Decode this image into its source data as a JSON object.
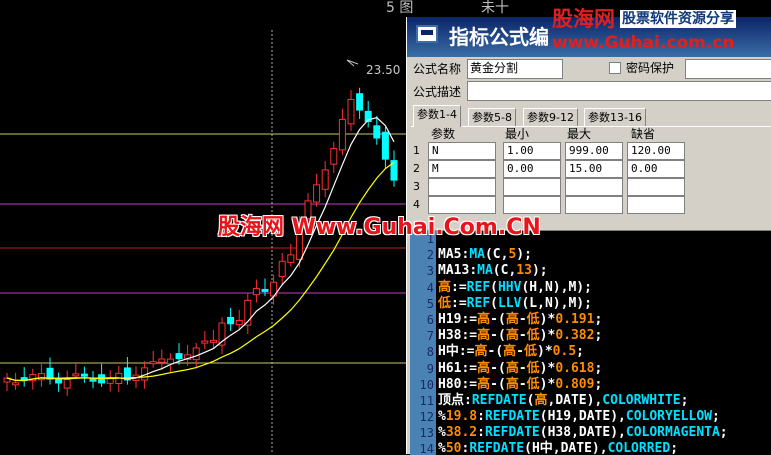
{
  "top_fragments": {
    "left": "5 图",
    "mid": "未十"
  },
  "chart_data": {
    "type": "candlestick",
    "peak_label": "23.50",
    "levels_note": "horizontal golden-section lines",
    "colors": {
      "up": "#ff3030",
      "down": "#00ffff",
      "ma5": "#ffffff",
      "ma13": "#ffff00",
      "line_yellow": "#ffff80",
      "line_magenta": "#c040c0",
      "line_red": "#c02020"
    }
  },
  "dialog": {
    "title": "指标公式编",
    "name_label": "公式名称",
    "name_value": "黄金分割",
    "password_label": "密码保护",
    "desc_label": "公式描述",
    "desc_value": "",
    "tabs": [
      "参数1-4",
      "参数5-8",
      "参数9-12",
      "参数13-16"
    ],
    "param_headers": [
      "参数",
      "最小",
      "最大",
      "缺省"
    ],
    "params": [
      {
        "n": "1",
        "name": "N",
        "min": "1.00",
        "max": "999.00",
        "def": "120.00"
      },
      {
        "n": "2",
        "name": "M",
        "min": "0.00",
        "max": "15.00",
        "def": "0.00"
      },
      {
        "n": "3",
        "name": "",
        "min": "",
        "max": "",
        "def": ""
      },
      {
        "n": "4",
        "name": "",
        "min": "",
        "max": "",
        "def": ""
      }
    ],
    "code": [
      {
        "n": "1",
        "tokens": []
      },
      {
        "n": "2",
        "tokens": [
          [
            "id",
            "MA5"
          ],
          [
            "op",
            ":"
          ],
          [
            "fn",
            "MA"
          ],
          [
            "op",
            "("
          ],
          [
            "id",
            "C"
          ],
          [
            "op",
            ","
          ],
          [
            "num",
            "5"
          ],
          [
            "op",
            ");"
          ]
        ]
      },
      {
        "n": "3",
        "tokens": [
          [
            "id",
            "MA13"
          ],
          [
            "op",
            ":"
          ],
          [
            "fn",
            "MA"
          ],
          [
            "op",
            "("
          ],
          [
            "id",
            "C"
          ],
          [
            "op",
            ","
          ],
          [
            "num",
            "13"
          ],
          [
            "op",
            ");"
          ]
        ]
      },
      {
        "n": "4",
        "tokens": [
          [
            "cn",
            "高"
          ],
          [
            "op",
            ":="
          ],
          [
            "fn",
            "REF"
          ],
          [
            "op",
            "("
          ],
          [
            "fn",
            "HHV"
          ],
          [
            "op",
            "("
          ],
          [
            "id",
            "H"
          ],
          [
            "op",
            ","
          ],
          [
            "id",
            "N"
          ],
          [
            "op",
            "),"
          ],
          [
            "id",
            "M"
          ],
          [
            "op",
            ");"
          ]
        ]
      },
      {
        "n": "5",
        "tokens": [
          [
            "cn",
            "低"
          ],
          [
            "op",
            ":="
          ],
          [
            "fn",
            "REF"
          ],
          [
            "op",
            "("
          ],
          [
            "fn",
            "LLV"
          ],
          [
            "op",
            "("
          ],
          [
            "id",
            "L"
          ],
          [
            "op",
            ","
          ],
          [
            "id",
            "N"
          ],
          [
            "op",
            "),"
          ],
          [
            "id",
            "M"
          ],
          [
            "op",
            ");"
          ]
        ]
      },
      {
        "n": "6",
        "tokens": [
          [
            "id",
            "H19"
          ],
          [
            "op",
            ":="
          ],
          [
            "cn",
            "高"
          ],
          [
            "op",
            "-("
          ],
          [
            "cn",
            "高"
          ],
          [
            "op",
            "-"
          ],
          [
            "cn",
            "低"
          ],
          [
            "op",
            ")*"
          ],
          [
            "num",
            "0.191"
          ],
          [
            "op",
            ";"
          ]
        ]
      },
      {
        "n": "7",
        "tokens": [
          [
            "id",
            "H38"
          ],
          [
            "op",
            ":="
          ],
          [
            "cn",
            "高"
          ],
          [
            "op",
            "-("
          ],
          [
            "cn",
            "高"
          ],
          [
            "op",
            "-"
          ],
          [
            "cn",
            "低"
          ],
          [
            "op",
            ")*"
          ],
          [
            "num",
            "0.382"
          ],
          [
            "op",
            ";"
          ]
        ]
      },
      {
        "n": "8",
        "tokens": [
          [
            "id",
            "H中"
          ],
          [
            "op",
            ":="
          ],
          [
            "cn",
            "高"
          ],
          [
            "op",
            "-("
          ],
          [
            "cn",
            "高"
          ],
          [
            "op",
            "-"
          ],
          [
            "cn",
            "低"
          ],
          [
            "op",
            ")*"
          ],
          [
            "num",
            "0.5"
          ],
          [
            "op",
            ";"
          ]
        ]
      },
      {
        "n": "9",
        "tokens": [
          [
            "id",
            "H61"
          ],
          [
            "op",
            ":="
          ],
          [
            "cn",
            "高"
          ],
          [
            "op",
            "-("
          ],
          [
            "cn",
            "高"
          ],
          [
            "op",
            "-"
          ],
          [
            "cn",
            "低"
          ],
          [
            "op",
            ")*"
          ],
          [
            "num",
            "0.618"
          ],
          [
            "op",
            ";"
          ]
        ]
      },
      {
        "n": "10",
        "tokens": [
          [
            "id",
            "H80"
          ],
          [
            "op",
            ":="
          ],
          [
            "cn",
            "高"
          ],
          [
            "op",
            "-("
          ],
          [
            "cn",
            "高"
          ],
          [
            "op",
            "-"
          ],
          [
            "cn",
            "低"
          ],
          [
            "op",
            ")*"
          ],
          [
            "num",
            "0.809"
          ],
          [
            "op",
            ";"
          ]
        ]
      },
      {
        "n": "11",
        "tokens": [
          [
            "id",
            "顶点"
          ],
          [
            "op",
            ":"
          ],
          [
            "fn",
            "REFDATE"
          ],
          [
            "op",
            "("
          ],
          [
            "cn",
            "高"
          ],
          [
            "op",
            ","
          ],
          [
            "id",
            "DATE"
          ],
          [
            "op",
            "),"
          ],
          [
            "fn",
            "COLORWHITE"
          ],
          [
            "op",
            ";"
          ]
        ]
      },
      {
        "n": "12",
        "tokens": [
          [
            "id",
            "%"
          ],
          [
            "num",
            "19.8"
          ],
          [
            "op",
            ":"
          ],
          [
            "fn",
            "REFDATE"
          ],
          [
            "op",
            "("
          ],
          [
            "id",
            "H19"
          ],
          [
            "op",
            ","
          ],
          [
            "id",
            "DATE"
          ],
          [
            "op",
            "),"
          ],
          [
            "fn",
            "COLORYELLOW"
          ],
          [
            "op",
            ";"
          ]
        ]
      },
      {
        "n": "13",
        "tokens": [
          [
            "id",
            "%"
          ],
          [
            "num",
            "38.2"
          ],
          [
            "op",
            ":"
          ],
          [
            "fn",
            "REFDATE"
          ],
          [
            "op",
            "("
          ],
          [
            "id",
            "H38"
          ],
          [
            "op",
            ","
          ],
          [
            "id",
            "DATE"
          ],
          [
            "op",
            "),"
          ],
          [
            "fn",
            "COLORMAGENTA"
          ],
          [
            "op",
            ";"
          ]
        ]
      },
      {
        "n": "14",
        "tokens": [
          [
            "id",
            "%"
          ],
          [
            "num",
            "50"
          ],
          [
            "op",
            ":"
          ],
          [
            "fn",
            "REFDATE"
          ],
          [
            "op",
            "("
          ],
          [
            "id",
            "H中"
          ],
          [
            "op",
            ","
          ],
          [
            "id",
            "DATE"
          ],
          [
            "op",
            "),"
          ],
          [
            "fn",
            "COLORRED"
          ],
          [
            "op",
            ";"
          ]
        ]
      }
    ]
  },
  "watermarks": {
    "small_cn": "股海网",
    "small_tag": "股票软件资源分享",
    "small_url": "www.Guhai.com.cn",
    "big": "股海网 Www.Guhai.Com.CN"
  }
}
